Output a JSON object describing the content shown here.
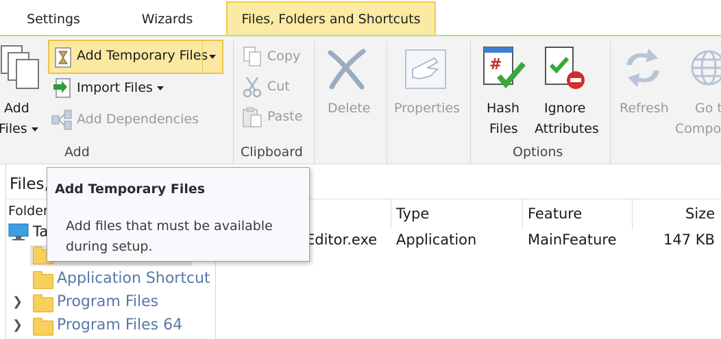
{
  "tabs": [
    {
      "label": "Settings"
    },
    {
      "label": "Wizards"
    },
    {
      "label": "Files, Folders and Shortcuts"
    }
  ],
  "ribbon": {
    "add_files": {
      "line1": "Add",
      "line2": "Files"
    },
    "add_temporary_files": "Add Temporary Files",
    "import_files": "Import Files",
    "add_dependencies": "Add Dependencies",
    "add_group": "Add",
    "copy": "Copy",
    "cut": "Cut",
    "paste": "Paste",
    "clipboard_group": "Clipboard",
    "delete": "Delete",
    "properties": "Properties",
    "hash_files": {
      "line1": "Hash",
      "line2": "Files"
    },
    "ignore_attributes": {
      "line1": "Ignore",
      "line2": "Attributes"
    },
    "options_group": "Options",
    "refresh": "Refresh",
    "go_to_component": {
      "line1": "Go t",
      "line2": "Compo"
    }
  },
  "pane": {
    "title": "Files,",
    "folder_header": "Folder",
    "columns": {
      "type": "Type",
      "feature": "Feature",
      "size": "Size"
    },
    "row": {
      "name": "Editor.exe",
      "type": "Application",
      "feature": "MainFeature",
      "size": "147 KB"
    },
    "tree": {
      "root": "Ta",
      "items": [
        "Application Shortcut",
        "Program Files",
        "Program Files 64"
      ]
    }
  },
  "tooltip": {
    "title": "Add Temporary Files",
    "body": "Add files that must be available during setup."
  },
  "colors": {
    "accent_highlight": "#fbe9a2",
    "accent_border": "#f0c24a",
    "tab_line": "#b9d98a",
    "tree_text": "#5978a8"
  }
}
